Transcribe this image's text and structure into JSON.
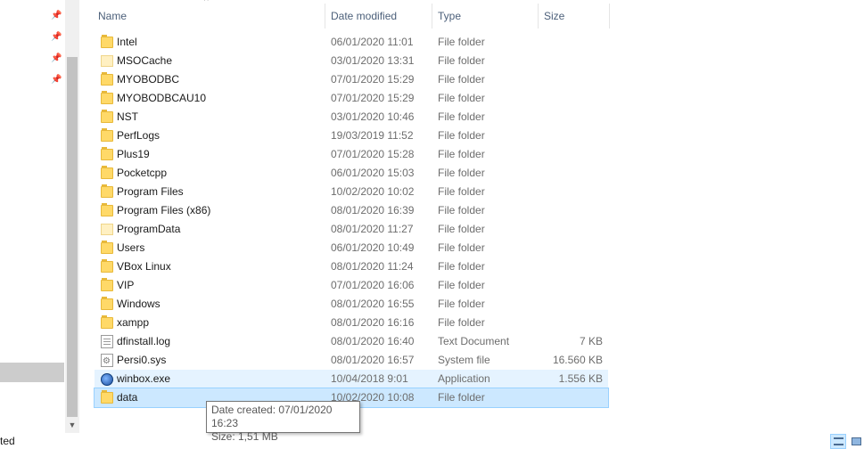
{
  "columns": {
    "name": "Name",
    "date": "Date modified",
    "type": "Type",
    "size": "Size"
  },
  "files": [
    {
      "name": "Intel",
      "date": "06/01/2020 11:01",
      "type": "File folder",
      "size": "",
      "icon": "folder-icon"
    },
    {
      "name": "MSOCache",
      "date": "03/01/2020 13:31",
      "type": "File folder",
      "size": "",
      "icon": "folder-empty-icon"
    },
    {
      "name": "MYOBODBC",
      "date": "07/01/2020 15:29",
      "type": "File folder",
      "size": "",
      "icon": "folder-icon"
    },
    {
      "name": "MYOBODBCAU10",
      "date": "07/01/2020 15:29",
      "type": "File folder",
      "size": "",
      "icon": "folder-icon"
    },
    {
      "name": "NST",
      "date": "03/01/2020 10:46",
      "type": "File folder",
      "size": "",
      "icon": "folder-icon"
    },
    {
      "name": "PerfLogs",
      "date": "19/03/2019 11:52",
      "type": "File folder",
      "size": "",
      "icon": "folder-icon"
    },
    {
      "name": "Plus19",
      "date": "07/01/2020 15:28",
      "type": "File folder",
      "size": "",
      "icon": "folder-icon"
    },
    {
      "name": "Pocketcpp",
      "date": "06/01/2020 15:03",
      "type": "File folder",
      "size": "",
      "icon": "folder-icon"
    },
    {
      "name": "Program Files",
      "date": "10/02/2020 10:02",
      "type": "File folder",
      "size": "",
      "icon": "folder-icon"
    },
    {
      "name": "Program Files (x86)",
      "date": "08/01/2020 16:39",
      "type": "File folder",
      "size": "",
      "icon": "folder-icon"
    },
    {
      "name": "ProgramData",
      "date": "08/01/2020 11:27",
      "type": "File folder",
      "size": "",
      "icon": "folder-empty-icon"
    },
    {
      "name": "Users",
      "date": "06/01/2020 10:49",
      "type": "File folder",
      "size": "",
      "icon": "folder-icon"
    },
    {
      "name": "VBox Linux",
      "date": "08/01/2020 11:24",
      "type": "File folder",
      "size": "",
      "icon": "folder-icon"
    },
    {
      "name": "VIP",
      "date": "07/01/2020 16:06",
      "type": "File folder",
      "size": "",
      "icon": "folder-icon"
    },
    {
      "name": "Windows",
      "date": "08/01/2020 16:55",
      "type": "File folder",
      "size": "",
      "icon": "folder-icon"
    },
    {
      "name": "xampp",
      "date": "08/01/2020 16:16",
      "type": "File folder",
      "size": "",
      "icon": "folder-icon"
    },
    {
      "name": "dfinstall.log",
      "date": "08/01/2020 16:40",
      "type": "Text Document",
      "size": "7 KB",
      "icon": "file-icon"
    },
    {
      "name": "Persi0.sys",
      "date": "08/01/2020 16:57",
      "type": "System file",
      "size": "16.560 KB",
      "icon": "sys-icon"
    },
    {
      "name": "winbox.exe",
      "date": "10/04/2018 9:01",
      "type": "Application",
      "size": "1.556 KB",
      "icon": "app-icon",
      "state": "hover"
    },
    {
      "name": "data",
      "date": "10/02/2020 10:08",
      "type": "File folder",
      "size": "",
      "icon": "folder-icon",
      "state": "selected"
    }
  ],
  "tooltip": {
    "line1": "Date created: 07/01/2020 16:23",
    "line2": "Size: 1,51 MB"
  },
  "status": {
    "text": "ted"
  },
  "pins": [
    "pin-icon",
    "pin-icon",
    "pin-icon",
    "pin-icon"
  ]
}
